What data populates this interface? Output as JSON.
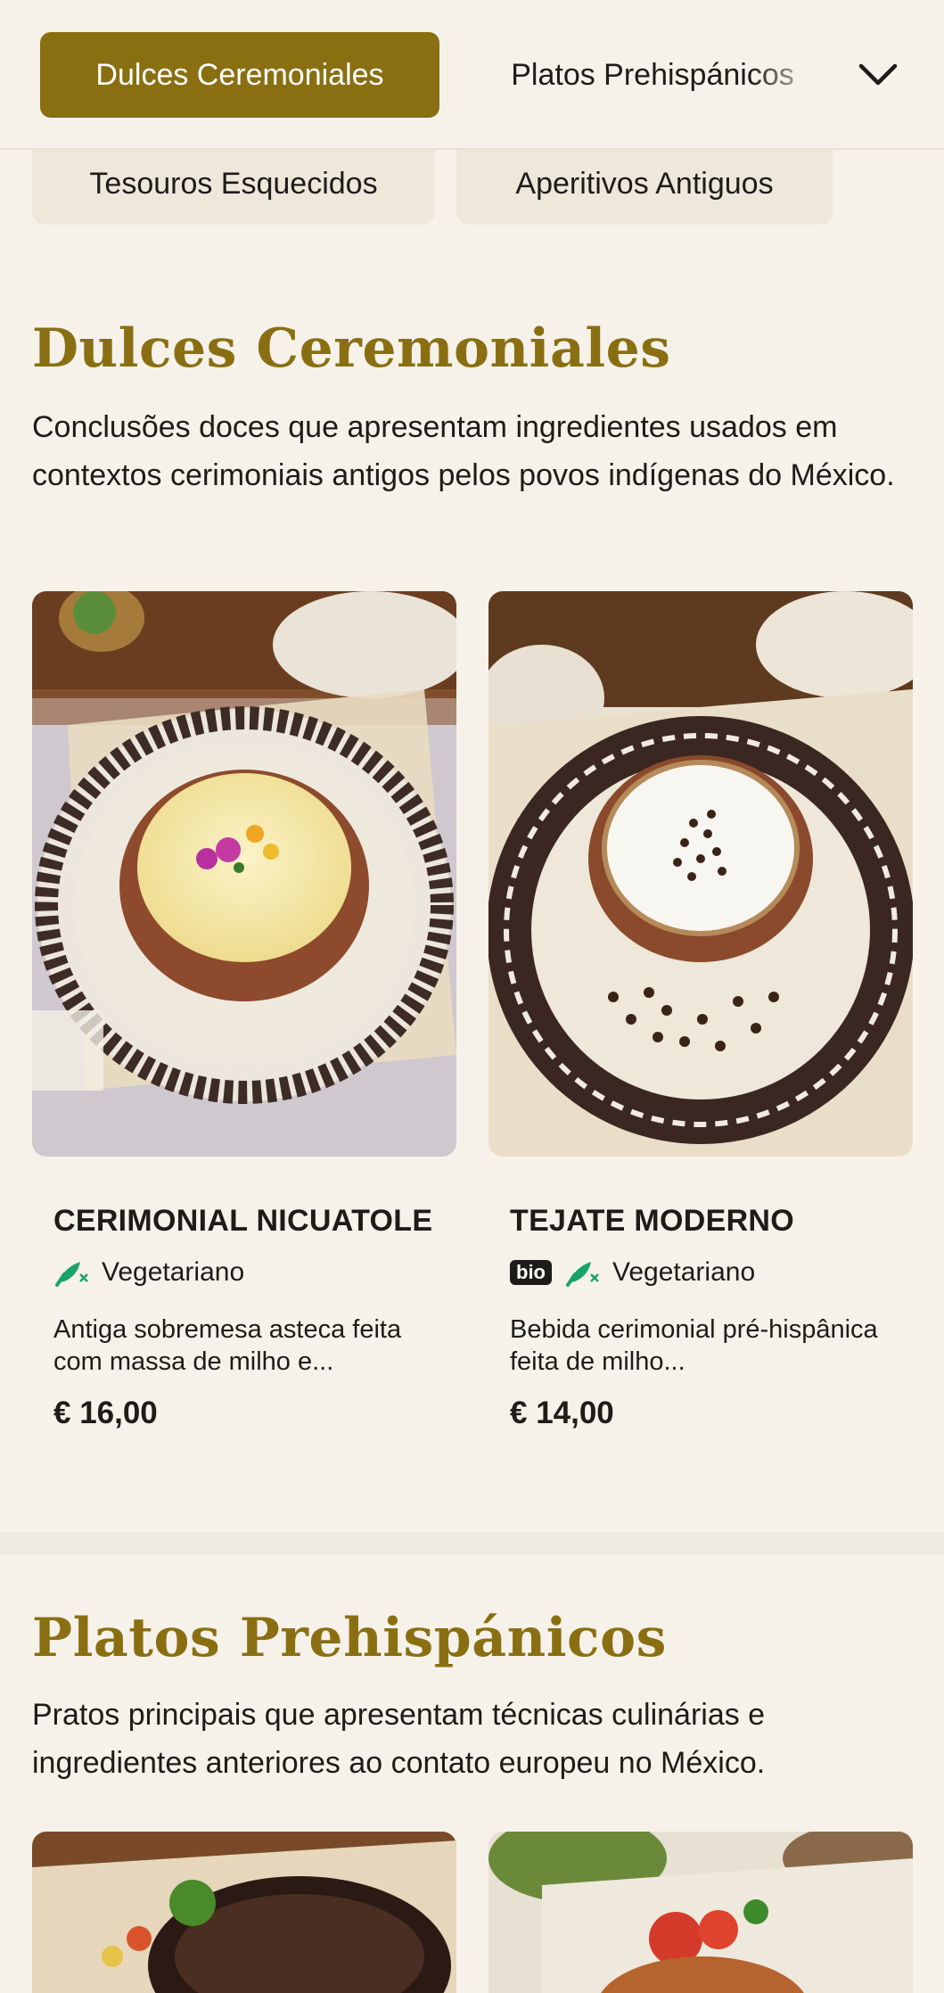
{
  "nav": {
    "active": "Dulces Ceremoniales",
    "next": "Platos Prehispánicos",
    "row2": [
      "Tesouros Esquecidos",
      "Aperitivos Antiguos"
    ]
  },
  "sections": [
    {
      "title": "Dulces Ceremoniales",
      "description": "Conclusões doces que apresentam ingredientes usados em contextos cerimoniais antigos pelos povos indígenas do México.",
      "items": [
        {
          "name": "Cerimonial Nicuatole",
          "badges": [
            "vegetarian"
          ],
          "diet": "Vegetariano",
          "description": "Antiga sobremesa asteca feita com massa de milho e...",
          "price": "€ 16,00"
        },
        {
          "name": "Tejate Moderno",
          "badges": [
            "bio",
            "vegetarian"
          ],
          "bio": "bio",
          "diet": "Vegetariano",
          "description": "Bebida cerimonial pré-hispânica feita de milho...",
          "price": "€ 14,00"
        }
      ]
    },
    {
      "title": "Platos Prehispánicos",
      "description": "Pratos principais que apresentam técnicas culinárias e ingredientes anteriores ao contato europeu no México."
    }
  ],
  "colors": {
    "accent": "#8a6f12",
    "background": "#f6f2ea",
    "pill": "#ede8da",
    "vegetarian": "#1aa36b"
  }
}
